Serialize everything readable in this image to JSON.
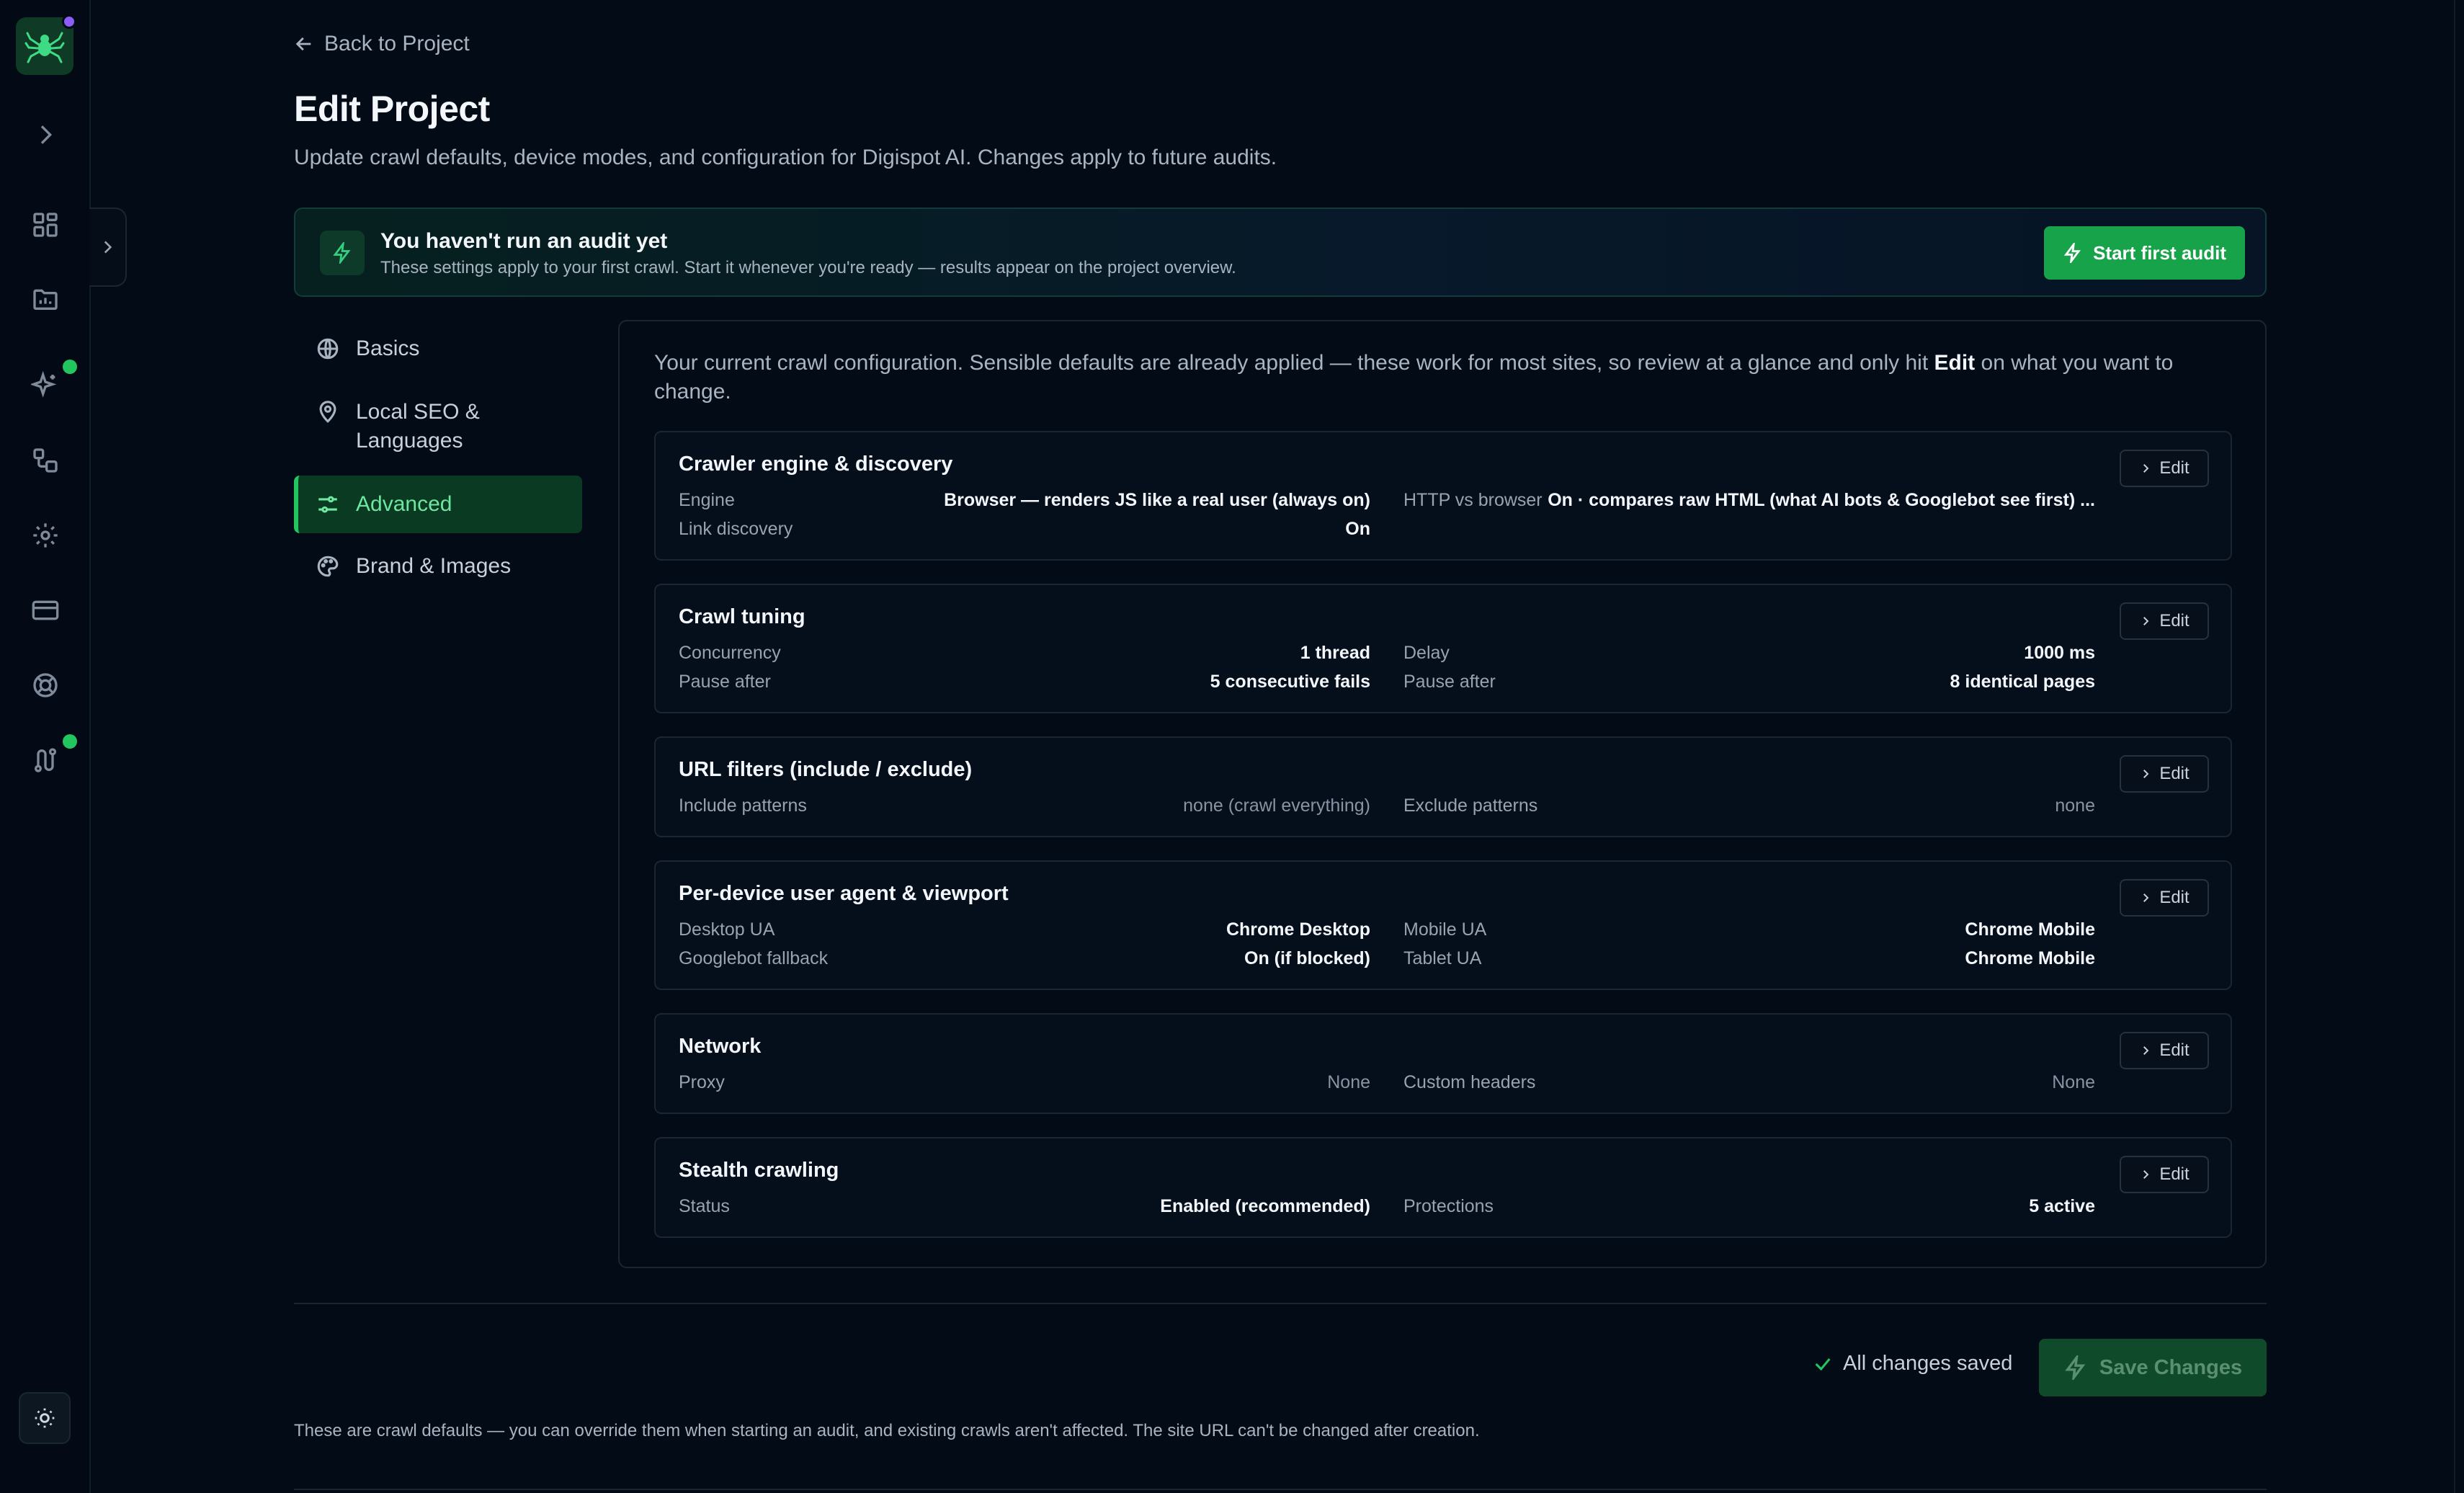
{
  "sidebar": {
    "logo": "spider-logo",
    "items": [
      {
        "name": "expand",
        "icon": "chevron-right-icon"
      },
      {
        "name": "dashboard",
        "icon": "grid-icon"
      },
      {
        "name": "reports",
        "icon": "chart-folder-icon"
      },
      {
        "name": "ai",
        "icon": "sparkles-icon",
        "badge": true
      },
      {
        "name": "workflows",
        "icon": "nodes-icon"
      },
      {
        "name": "settings",
        "icon": "gear-icon"
      },
      {
        "name": "billing",
        "icon": "credit-card-icon"
      },
      {
        "name": "support",
        "icon": "lifebuoy-icon"
      },
      {
        "name": "integrations",
        "icon": "route-icon",
        "badge": true
      }
    ],
    "theme_toggle_icon": "sun-icon"
  },
  "header": {
    "back_label": "Back to Project",
    "title": "Edit Project",
    "subtitle": "Update crawl defaults, device modes, and configuration for Digispot AI. Changes apply to future audits."
  },
  "banner": {
    "title": "You haven't run an audit yet",
    "text": "These settings apply to your first crawl. Start it whenever you're ready — results appear on the project overview.",
    "button_label": "Start first audit"
  },
  "nav": {
    "items": [
      {
        "label": "Basics",
        "icon": "globe-icon"
      },
      {
        "label": "Local SEO & Languages",
        "icon": "map-pin-icon"
      },
      {
        "label": "Advanced",
        "icon": "sliders-icon",
        "active": true
      },
      {
        "label": "Brand & Images",
        "icon": "palette-icon"
      }
    ]
  },
  "panel": {
    "intro_before": "Your current crawl configuration. Sensible defaults are already applied — these work for most sites, so review at a glance and only hit ",
    "intro_strong": "Edit",
    "intro_after": " on what you want to change.",
    "edit_label": "Edit",
    "cards": [
      {
        "title": "Crawler engine & discovery",
        "rows": [
          {
            "k": "Engine",
            "v": "Browser — renders JS like a real user (always on)"
          },
          {
            "k": "HTTP vs browser",
            "v": "On · compares raw HTML (what AI bots & Googlebot see first) ..."
          },
          {
            "k": "Link discovery",
            "v": "On"
          }
        ]
      },
      {
        "title": "Crawl tuning",
        "rows": [
          {
            "k": "Concurrency",
            "v": "1 thread"
          },
          {
            "k": "Delay",
            "v": "1000 ms"
          },
          {
            "k": "Pause after",
            "v": "5 consecutive fails"
          },
          {
            "k": "Pause after",
            "v": "8 identical pages"
          }
        ]
      },
      {
        "title": "URL filters (include / exclude)",
        "rows": [
          {
            "k": "Include patterns",
            "v": "none (crawl everything)"
          },
          {
            "k": "Exclude patterns",
            "v": "none"
          }
        ]
      },
      {
        "title": "Per-device user agent & viewport",
        "rows": [
          {
            "k": "Desktop UA",
            "v": "Chrome Desktop"
          },
          {
            "k": "Mobile UA",
            "v": "Chrome Mobile"
          },
          {
            "k": "Googlebot fallback",
            "v": "On (if blocked)"
          },
          {
            "k": "Tablet UA",
            "v": "Chrome Mobile"
          }
        ]
      },
      {
        "title": "Network",
        "rows": [
          {
            "k": "Proxy",
            "v": "None"
          },
          {
            "k": "Custom headers",
            "v": "None"
          }
        ]
      },
      {
        "title": "Stealth crawling",
        "rows": [
          {
            "k": "Status",
            "v": "Enabled (recommended)"
          },
          {
            "k": "Protections",
            "v": "5 active"
          }
        ]
      }
    ]
  },
  "footer": {
    "saved_label": "All changes saved",
    "save_button": "Save Changes",
    "note": "These are crawl defaults — you can override them when starting an audit, and existing crawls aren't affected. The site URL can't be changed after creation."
  },
  "colors": {
    "background": "#030b17",
    "accent": "#22c55e",
    "primary_button": "#16a34a",
    "notification_dot": "#8b5cf6"
  }
}
